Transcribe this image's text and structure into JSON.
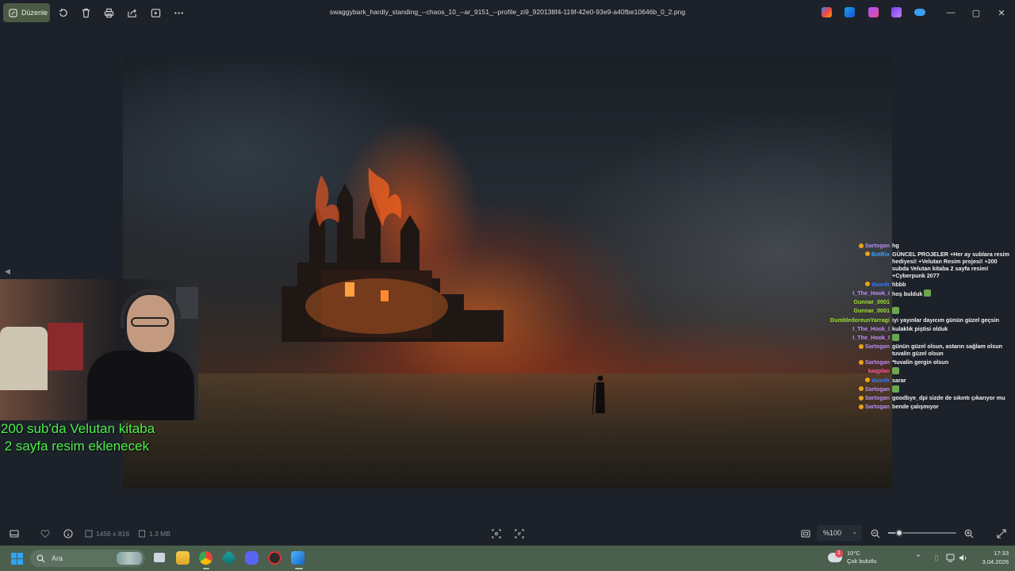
{
  "toolbar": {
    "edit_label": "Düzenle",
    "file_title": "swaggybark_hardly_standing_--chaos_10_--ar_9151_--profile_zi9_920138f4-119f-42e0-93e9-a40fbe10646b_0_2.png",
    "icons": [
      "rotate-icon",
      "delete-icon",
      "print-icon",
      "share-icon",
      "slideshow-icon",
      "more-icon"
    ],
    "window_controls": {
      "minimize": "—",
      "maximize": "▢",
      "close": "✕"
    }
  },
  "overlay": {
    "line1": "200 sub'da Velutan kitaba",
    "line2": " 2 sayfa resim eklenecek",
    "color": "#4cf04a"
  },
  "chat": {
    "messages": [
      {
        "user": "Sartogan",
        "color": "#b98cf2",
        "badge": true,
        "text": "hg"
      },
      {
        "user": "BotRix",
        "color": "#3aa0ff",
        "badge": true,
        "text": "GÜNCEL PROJELER +Her ay sublara resim hediyesi! +Velutan Resim projesi! +200 subda Velutan kitaba 2 sayfa resim! +Cyberpunk 2077"
      },
      {
        "user": "dsordr",
        "color": "#3d7bff",
        "badge": true,
        "text": "hbbb"
      },
      {
        "user": "I_The_Hook_I",
        "color": "#c58cff",
        "badge": false,
        "text": "hoş bulduk",
        "emote": true
      },
      {
        "user": "Gunnar_0001",
        "color": "#9be22e",
        "badge": false,
        "text": ""
      },
      {
        "user": "Gunnar_0001",
        "color": "#9be22e",
        "badge": false,
        "text": "",
        "emote": true
      },
      {
        "user": "DumbledoreunYarragi",
        "color": "#9be22e",
        "badge": false,
        "text": "iyi yayınlar dayıcım günün güzel geçsin"
      },
      {
        "user": "I_The_Hook_I",
        "color": "#c58cff",
        "badge": false,
        "text": "kulaklık piştisi olduk"
      },
      {
        "user": "I_The_Hook_I",
        "color": "#c58cff",
        "badge": false,
        "text": "",
        "emote": true
      },
      {
        "user": "Sartogan",
        "color": "#b98cf2",
        "badge": true,
        "text": "günün güzel olsun, astarın sağlam olsun tuvalin güzel olsun"
      },
      {
        "user": "Sartogan",
        "color": "#b98cf2",
        "badge": true,
        "text": "*tuvalin gergin olsun"
      },
      {
        "user": "kaqplan",
        "color": "#ff5aa0",
        "badge": false,
        "text": "",
        "emote": true
      },
      {
        "user": "dsordr",
        "color": "#3d7bff",
        "badge": true,
        "text": "sarar"
      },
      {
        "user": "Sartogan",
        "color": "#b98cf2",
        "badge": true,
        "text": "",
        "emote": true
      },
      {
        "user": "Sartogan",
        "color": "#b98cf2",
        "badge": true,
        "text": "goodbye_dpi sizde de sıkıntı çıkarıyor mu"
      },
      {
        "user": "Sartogan",
        "color": "#b98cf2",
        "badge": true,
        "text": "bende çalışmıyor"
      }
    ]
  },
  "bottombar": {
    "dimensions": "1456 x 816",
    "file_size": "1.3 MB",
    "zoom": "%100",
    "zoom_level": 0.16
  },
  "taskbar": {
    "search_placeholder": "Ara",
    "weather_temp": "10°C",
    "weather_desc": "Çok bulutlu",
    "notification_count": "1",
    "time": "17:33",
    "date": "3.04.2026"
  }
}
